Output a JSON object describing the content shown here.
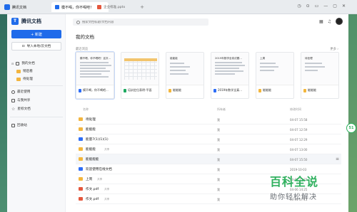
{
  "browser": {
    "app_tab": "腾讯文档",
    "doc_tab": "模不喝，你不喝吧！",
    "pdf_tab": "企业标准.pptx",
    "new_tab_symbol": "+",
    "controls": [
      "◷",
      "⊙",
      "▭",
      "—",
      "▢",
      "✕"
    ]
  },
  "sidebar": {
    "brand": "腾讯文档",
    "new_button": "+ 新建",
    "import_button": "导入本地/云文档",
    "items": [
      {
        "label": "我的文档",
        "icon": "folder-tree-icon"
      },
      {
        "label": "稍后看",
        "icon": "folder-icon",
        "sub": true
      },
      {
        "label": "待处理",
        "icon": "folder-icon",
        "sub": true
      },
      {
        "label": "最近使用",
        "icon": "clock-icon"
      },
      {
        "label": "与我共享",
        "icon": "share-icon"
      },
      {
        "label": "星标文档",
        "icon": "star-icon"
      },
      {
        "label": "回收站",
        "icon": "trash-icon"
      }
    ]
  },
  "header": {
    "search_placeholder": "搜索文档标题/文档内容",
    "icons": [
      "grid-icon",
      "bell-icon",
      "avatar"
    ]
  },
  "main": {
    "title": "我的文档",
    "recent_label": "最近浏览",
    "more_label": "更多 ›",
    "cards": [
      {
        "title": "模不喝，你不喝吧...",
        "thumb_title": "模不喝，你不喝吧！这次...",
        "type": "word"
      },
      {
        "title": "培训定位表明-平面",
        "thumb_title": "",
        "type": "excel"
      },
      {
        "title": "能能能",
        "thumb_title": "能能能",
        "type": "sheet"
      },
      {
        "title": "2019年数学全真...",
        "thumb_title": "2019年数学全真试题...",
        "type": "word"
      },
      {
        "title": "能能能",
        "thumb_title": "上周",
        "type": "sheet"
      },
      {
        "title": "能能能",
        "thumb_title": "待处理",
        "type": "sheet"
      }
    ],
    "columns": {
      "name": "名称",
      "owner": "所有者",
      "date": "修改时间"
    },
    "rows": [
      {
        "name": "待处理",
        "tag": "",
        "owner": "我",
        "date": "04-07 15:58",
        "type": "folder"
      },
      {
        "name": "能能能",
        "tag": "",
        "owner": "我",
        "date": "04-07 12:59",
        "type": "folder"
      },
      {
        "name": "能量7(1)(1)(1)",
        "tag": "",
        "owner": "我",
        "date": "04-07 12:29",
        "type": "word"
      },
      {
        "name": "能能能",
        "tag": "共享",
        "owner": "我",
        "date": "04-07 13:00",
        "type": "sheet"
      },
      {
        "name": "能能能能",
        "tag": "",
        "owner": "我",
        "date": "04-07 15:50",
        "type": "sheet",
        "highlight": true,
        "menu": "≡"
      },
      {
        "name": "欢迎使用在线文档",
        "tag": "",
        "owner": "我",
        "date": "2019-10-03",
        "type": "word"
      },
      {
        "name": "上周",
        "tag": "共享",
        "owner": "我",
        "date": "04-07 15:22",
        "type": "sheet"
      },
      {
        "name": "作文.pdf",
        "tag": "共享",
        "owner": "我",
        "date": "04-06 14:25",
        "type": "pdf"
      },
      {
        "name": "作文.pdf",
        "tag": "共享",
        "owner": "我",
        "date": "03-31 17:11",
        "type": "pdf"
      }
    ]
  },
  "overlay": {
    "watermark_line1": "百科全说",
    "watermark_line2": "助你轻松解决",
    "badge": "51"
  }
}
